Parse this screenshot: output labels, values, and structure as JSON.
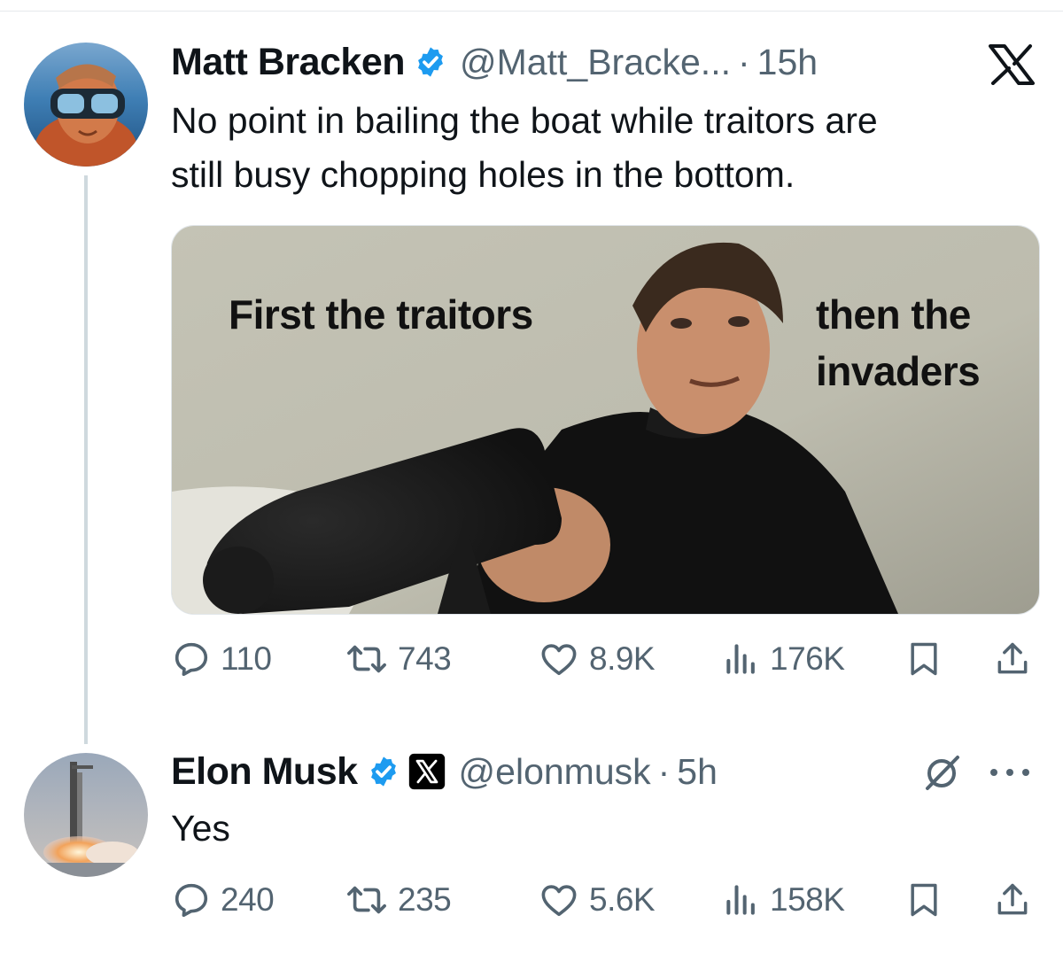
{
  "tweets": [
    {
      "author_name": "Matt Bracken",
      "handle": "@Matt_Bracke...",
      "separator": "·",
      "time": "15h",
      "text_lines": [
        "No point in bailing the boat while traitors are",
        "still busy chopping holes in the bottom."
      ],
      "media": {
        "caption_left": "First the traitors",
        "caption_right_lines": [
          "then the",
          "invaders"
        ]
      },
      "stats": {
        "replies": "110",
        "retweets": "743",
        "likes": "8.9K",
        "views": "176K"
      }
    },
    {
      "author_name": "Elon Musk",
      "handle": "@elonmusk",
      "separator": "·",
      "time": "5h",
      "text": "Yes",
      "stats": {
        "replies": "240",
        "retweets": "235",
        "likes": "5.6K",
        "views": "158K"
      }
    }
  ],
  "icons": {
    "verified": "verified-badge-icon",
    "x_logo": "x-logo-icon",
    "reply": "reply-icon",
    "retweet": "retweet-icon",
    "like": "heart-icon",
    "views": "views-icon",
    "bookmark": "bookmark-icon",
    "share": "share-icon",
    "grok": "grok-icon",
    "more": "more-icon"
  },
  "colors": {
    "verified": "#1d9bf0",
    "secondary_text": "#536471",
    "primary_text": "#0f1419",
    "thread_line": "#cfd9de"
  }
}
